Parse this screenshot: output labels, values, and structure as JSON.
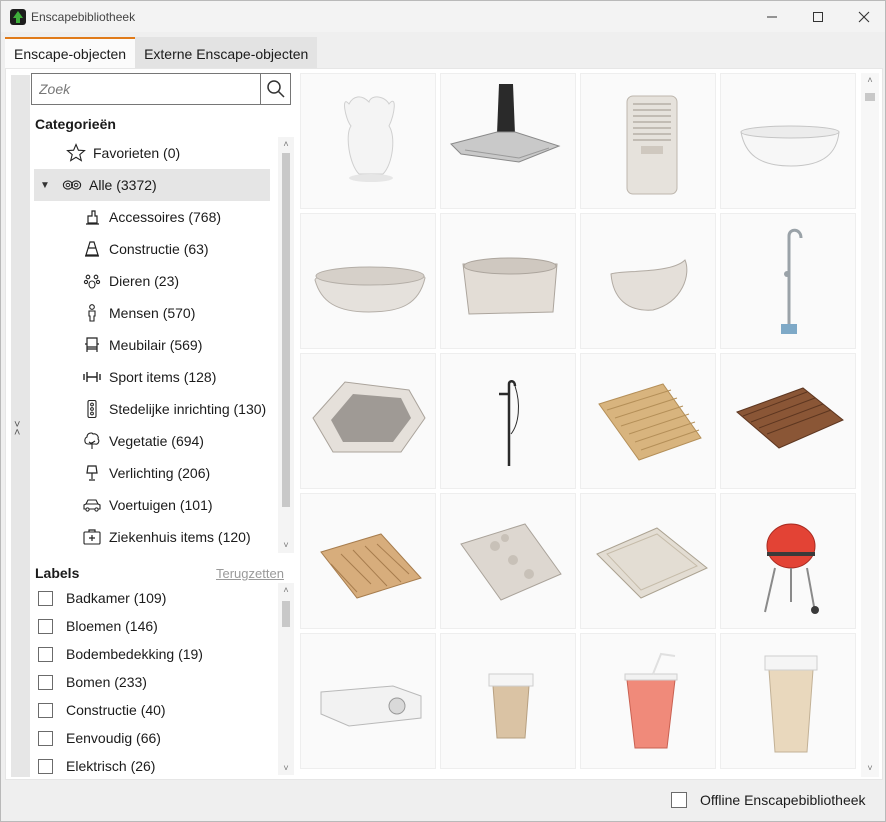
{
  "window": {
    "title": "Enscapebibliotheek"
  },
  "tabs": [
    {
      "label": "Enscape-objecten",
      "active": true
    },
    {
      "label": "Externe Enscape-objecten",
      "active": false
    }
  ],
  "search": {
    "placeholder": "Zoek",
    "value": ""
  },
  "categories": {
    "heading": "Categorieën",
    "favorites": "Favorieten (0)",
    "all": "Alle (3372)",
    "items": [
      {
        "label": "Accessoires (768)",
        "icon": "accessories-icon"
      },
      {
        "label": "Constructie (63)",
        "icon": "traffic-cone-icon"
      },
      {
        "label": "Dieren (23)",
        "icon": "paw-icon"
      },
      {
        "label": "Mensen (570)",
        "icon": "person-icon"
      },
      {
        "label": "Meubilair (569)",
        "icon": "chair-icon"
      },
      {
        "label": "Sport items (128)",
        "icon": "dumbbell-icon"
      },
      {
        "label": "Stedelijke inrichting (130)",
        "icon": "traffic-light-icon"
      },
      {
        "label": "Vegetatie (694)",
        "icon": "tree-icon"
      },
      {
        "label": "Verlichting (206)",
        "icon": "lamp-icon"
      },
      {
        "label": "Voertuigen (101)",
        "icon": "car-icon"
      },
      {
        "label": "Ziekenhuis items (120)",
        "icon": "medical-kit-icon"
      }
    ]
  },
  "labels": {
    "heading": "Labels",
    "reset": "Terugzetten",
    "items": [
      {
        "label": "Badkamer (109)",
        "checked": false
      },
      {
        "label": "Bloemen (146)",
        "checked": false
      },
      {
        "label": "Bodembedekking (19)",
        "checked": false
      },
      {
        "label": "Bomen (233)",
        "checked": false
      },
      {
        "label": "Constructie (40)",
        "checked": false
      },
      {
        "label": "Eenvoudig (66)",
        "checked": false
      },
      {
        "label": "Elektrisch (26)",
        "checked": false
      }
    ]
  },
  "assets": [
    "cactus-planter",
    "range-hood",
    "air-cooler",
    "bathtub-white",
    "bathtub-oval",
    "bathtub-rectangular",
    "bathtub-slipper",
    "floor-faucet",
    "corner-whirlpool",
    "floor-mixer-black",
    "bath-mat-wooden-light",
    "bath-mat-wooden-dark",
    "bath-mat-pattern",
    "bath-mat-pebble",
    "floor-rug",
    "kettle-grill",
    "projector",
    "coffee-cup",
    "soda-cup",
    "paper-cup"
  ],
  "footer": {
    "offline_label": "Offline Enscapebibliotheek",
    "offline_checked": false
  },
  "colors": {
    "accent": "#e07b1a",
    "selection": "#e5e5e5"
  }
}
